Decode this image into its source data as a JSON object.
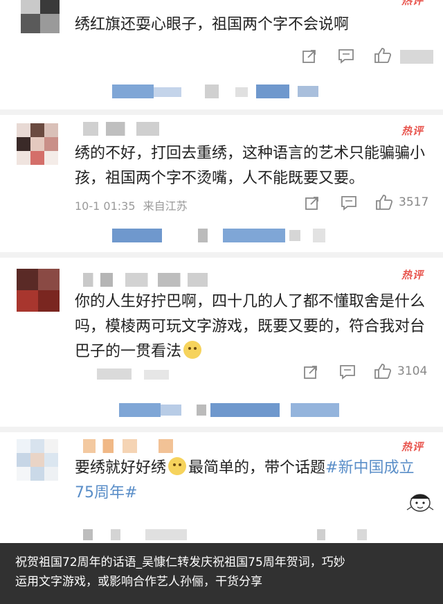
{
  "comments": [
    {
      "text": "绣红旗还耍心眼子，祖国两个字不会说啊",
      "hot_label": "热评",
      "icons": [
        "share-icon",
        "comment-icon",
        "like-icon"
      ]
    },
    {
      "text": "绣的不好，打回去重绣，这种语言的艺术只能骗骗小孩，祖国两个字不烫嘴，人不能既要又要。",
      "hot_label": "热评",
      "time": "10-1 01:35",
      "source": "来自江苏",
      "likes": "3517"
    },
    {
      "text": "你的人生好拧巴啊，四十几的人了都不懂取舍是什么吗，模棱两可玩文字游戏，既要又要的，符合我对台巴子的一贯看法",
      "hot_label": "热评",
      "likes": "3104"
    },
    {
      "text_part1": "要绣就好好绣",
      "text_part2": "最简单的，带个话题",
      "topic": "#新中国成立75周年#",
      "hot_label": "热评"
    }
  ],
  "caption": {
    "line1": "祝贺祖国72周年的话语_吴慷仁转发庆祝祖国75周年贺词，巧妙",
    "line2": "运用文字游戏，或影响合作艺人孙俪，干货分享"
  },
  "colors": {
    "hot": "#e8554e",
    "topic": "#5a8ec8",
    "meta": "#9a9a9a",
    "caption_bg": "#141414"
  }
}
